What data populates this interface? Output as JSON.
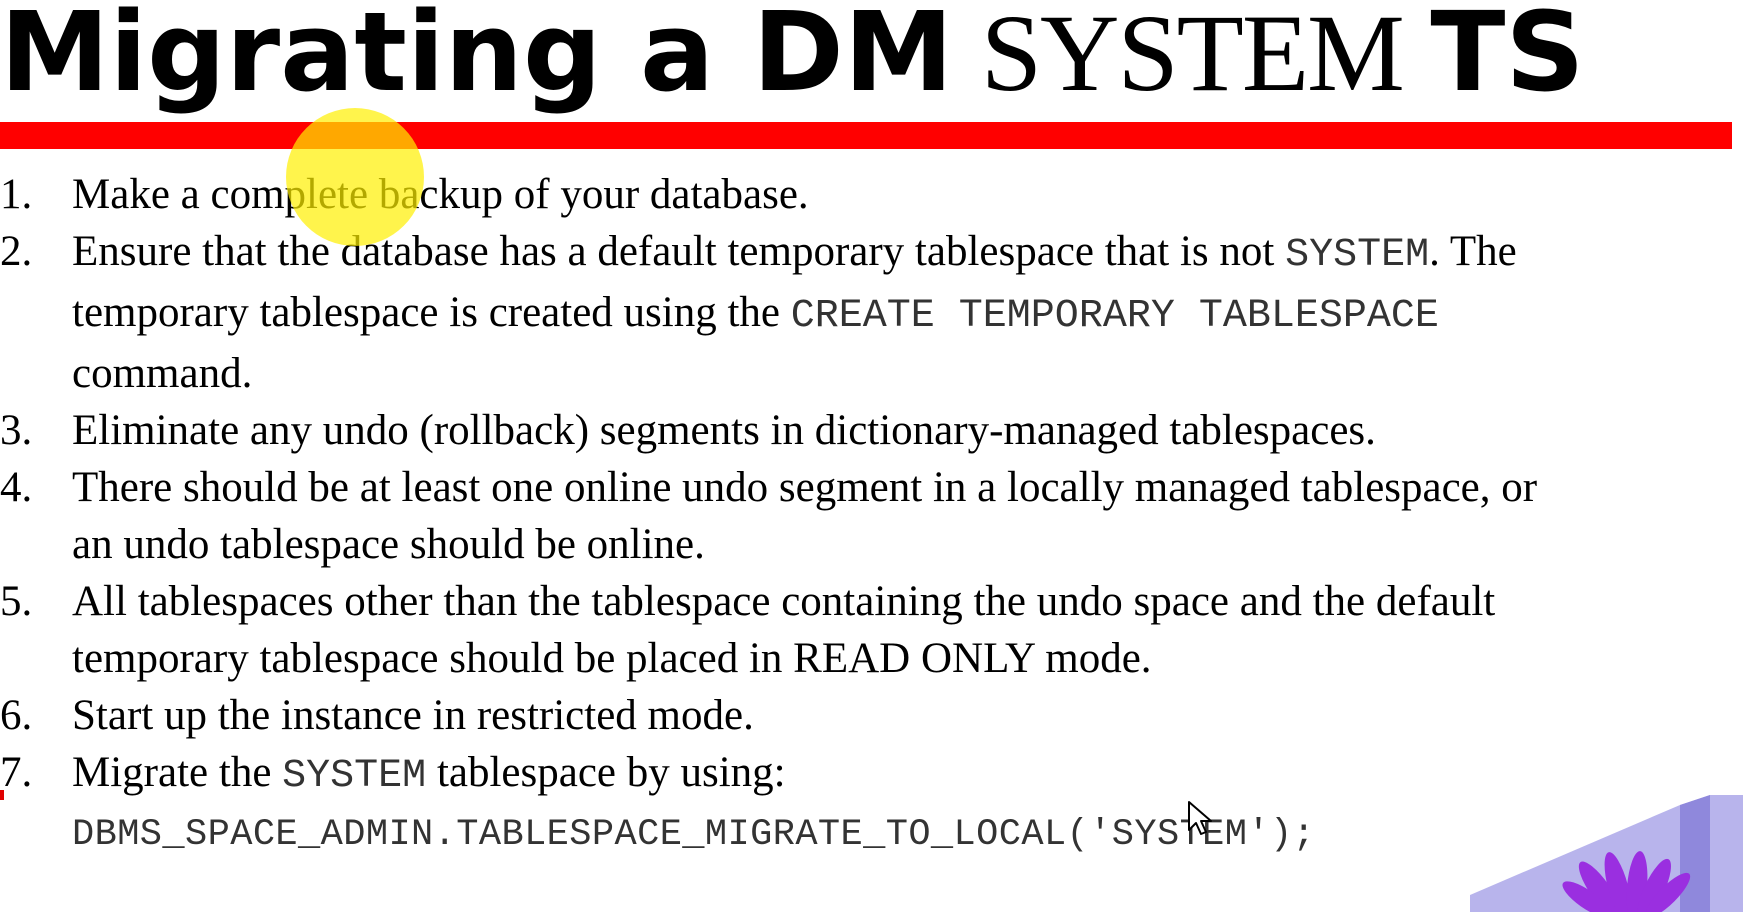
{
  "title": {
    "part1": "Migrating a DM",
    "part2": "SYSTEM",
    "part3": "TS"
  },
  "steps": [
    {
      "num": "1.",
      "text": "Make a complete backup of your database."
    },
    {
      "num": "2.",
      "line1a": "Ensure that the database has a default temporary tablespace that is not",
      "line1code": "SYSTEM",
      "line1b": ". The",
      "line2a": "temporary tablespace is created using the",
      "line2code": "CREATE TEMPORARY TABLESPACE",
      "line3": "command."
    },
    {
      "num": "3.",
      "text": "Eliminate any undo (rollback) segments in dictionary-managed tablespaces."
    },
    {
      "num": "4.",
      "line1": "There should be at least one online undo segment in a locally managed tablespace, or",
      "line2": "an undo tablespace should be online."
    },
    {
      "num": "5.",
      "line1": "All tablespaces other than the tablespace containing the undo space and the default",
      "line2": "temporary tablespace should be placed in READ ONLY mode."
    },
    {
      "num": "6.",
      "text": "Start up the instance in restricted mode."
    },
    {
      "num": "7.",
      "line1a": "Migrate the",
      "line1code": "SYSTEM",
      "line1b": "tablespace by using:",
      "code": "DBMS_SPACE_ADMIN.TABLESPACE_MIGRATE_TO_LOCAL('SYSTEM');"
    }
  ],
  "colors": {
    "bar": "#ff0000",
    "highlight": "#fff000",
    "graphic_purple": "#8a2be2"
  },
  "icons": [
    "mouse-cursor-icon",
    "flower-graphic-icon"
  ]
}
